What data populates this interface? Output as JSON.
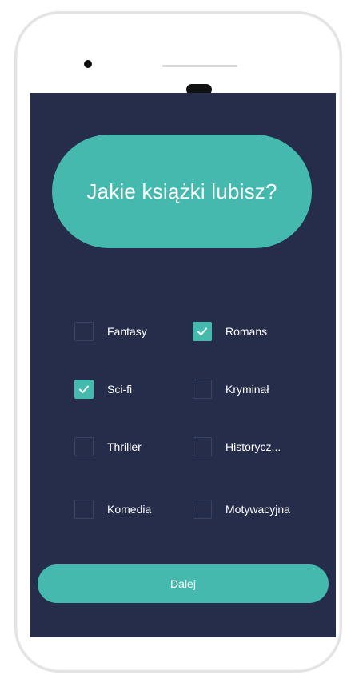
{
  "title": "Jakie książki lubisz?",
  "options": [
    {
      "label": "Fantasy",
      "checked": false
    },
    {
      "label": "Romans",
      "checked": true
    },
    {
      "label": "Sci-fi",
      "checked": true
    },
    {
      "label": "Kryminał",
      "checked": false
    },
    {
      "label": "Thriller",
      "checked": false
    },
    {
      "label": "Historycz...",
      "checked": false
    },
    {
      "label": "Komedia",
      "checked": false
    },
    {
      "label": "Motywacyjna",
      "checked": false
    }
  ],
  "next_label": "Dalej",
  "colors": {
    "accent": "#45b9ad",
    "screen_background": "#252d4a",
    "text": "#ffffff"
  }
}
